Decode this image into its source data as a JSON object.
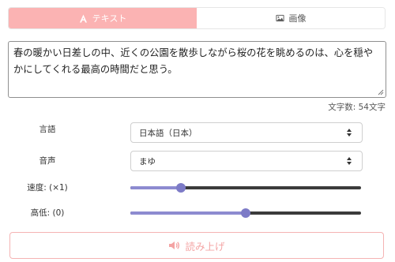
{
  "tabs": [
    {
      "label": "テキスト",
      "icon": "font-icon",
      "active": true
    },
    {
      "label": "画像",
      "icon": "image-icon",
      "active": false
    }
  ],
  "text_input": {
    "value": "春の暖かい日差しの中、近くの公園を散歩しながら桜の花を眺めるのは、心を穏やかにしてくれる最高の時間だと思う。"
  },
  "char_count": "文字数: 54文字",
  "language": {
    "label": "言語",
    "selected": "日本語（日本）"
  },
  "voice": {
    "label": "音声",
    "selected": "まゆ"
  },
  "speed": {
    "label": "速度: (×1)",
    "level_percent": 22
  },
  "pitch": {
    "label": "高低: (0)",
    "level_percent": 50
  },
  "read_button": {
    "label": "読み上げ",
    "icon": "speaker-icon"
  },
  "colors": {
    "accent": "#fbb3b3",
    "slider": "#8d8bd0",
    "button_text": "#f4a4a4"
  }
}
